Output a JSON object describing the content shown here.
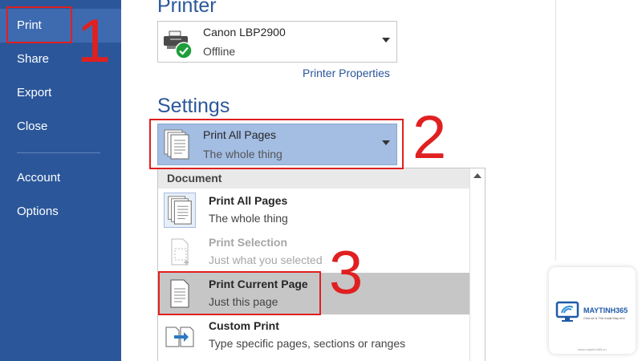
{
  "nav": {
    "items": [
      {
        "label": "Print",
        "active": true
      },
      {
        "label": "Share"
      },
      {
        "label": "Export"
      },
      {
        "label": "Close"
      },
      {
        "label": "Account"
      },
      {
        "label": "Options"
      }
    ]
  },
  "printer": {
    "section_title": "Printer",
    "name": "Canon LBP2900",
    "status": "Offline",
    "icon": "printer-icon",
    "status_icon": "check-circle-icon",
    "properties_link": "Printer Properties"
  },
  "settings": {
    "section_title": "Settings",
    "selected_title": "Print All Pages",
    "selected_sub": "The whole thing",
    "dropdown": {
      "header": "Document",
      "options": [
        {
          "title": "Print All Pages",
          "sub": "The whole thing",
          "icon": "all-pages-icon"
        },
        {
          "title": "Print Selection",
          "sub": "Just what you selected",
          "icon": "selection-icon",
          "disabled": true
        },
        {
          "title": "Print Current Page",
          "sub": "Just this page",
          "icon": "current-page-icon"
        },
        {
          "title": "Custom Print",
          "sub": "Type specific pages, sections or ranges",
          "icon": "custom-print-icon"
        }
      ]
    }
  },
  "annotations": [
    "1",
    "2",
    "3"
  ],
  "watermark": {
    "brand": "MAYTINH365",
    "tagline": "Chia sẻ & Thủ thuật Máy tính",
    "url": "www.maytinh365.vn"
  },
  "colors": {
    "nav_bg": "#2b579a",
    "accent_blue": "#2b579a",
    "highlight": "#a3bde3",
    "annotation_red": "#e02020"
  }
}
